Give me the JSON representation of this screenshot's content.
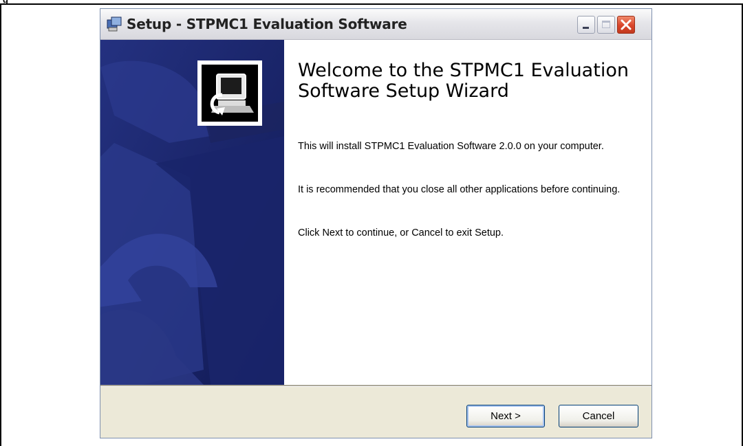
{
  "caption_fragment": "g",
  "window": {
    "title": "Setup - STPMC1 Evaluation Software",
    "controls": [
      "minimize",
      "maximize",
      "close"
    ]
  },
  "wizard": {
    "heading": "Welcome to the STPMC1 Evaluation Software Setup Wizard",
    "paragraphs": [
      "This will install STPMC1 Evaluation Software 2.0.0 on your computer.",
      "It is recommended that you close all other applications before continuing.",
      "Click Next to continue, or Cancel to exit Setup."
    ]
  },
  "buttons": {
    "next": "Next >",
    "cancel": "Cancel"
  },
  "colors": {
    "side_panel": "#1f2a6e",
    "close_button": "#d9442a",
    "window_bg": "#ece9d8"
  },
  "icons": {
    "title": "setup-installer-icon",
    "side": "computer-install-icon"
  }
}
